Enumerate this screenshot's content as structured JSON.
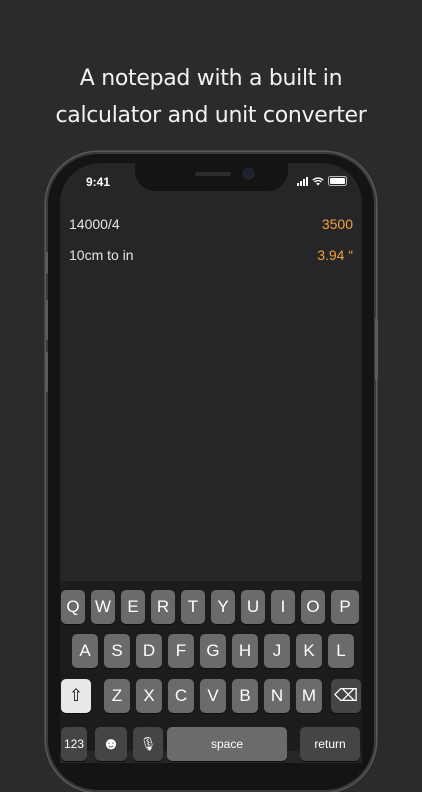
{
  "headline": {
    "line1": "A notepad with a built in",
    "line2": "calculator and unit converter"
  },
  "status_bar": {
    "time": "9:41"
  },
  "notes": [
    {
      "expression": "14000/4",
      "result": "3500"
    },
    {
      "expression": "10cm to in",
      "result": "3.94 “"
    }
  ],
  "keyboard": {
    "row1": [
      "Q",
      "W",
      "E",
      "R",
      "T",
      "Y",
      "U",
      "I",
      "O",
      "P"
    ],
    "row2": [
      "A",
      "S",
      "D",
      "F",
      "G",
      "H",
      "J",
      "K",
      "L"
    ],
    "row3": [
      "Z",
      "X",
      "C",
      "V",
      "B",
      "N",
      "M"
    ],
    "shift": "⇧",
    "delete": "⌫",
    "numbers": "123",
    "emoji": "☻",
    "mic": "🎙",
    "space": "space",
    "return": "return"
  },
  "colors": {
    "background": "#2b2b2d",
    "result_accent": "#f2a33a"
  }
}
